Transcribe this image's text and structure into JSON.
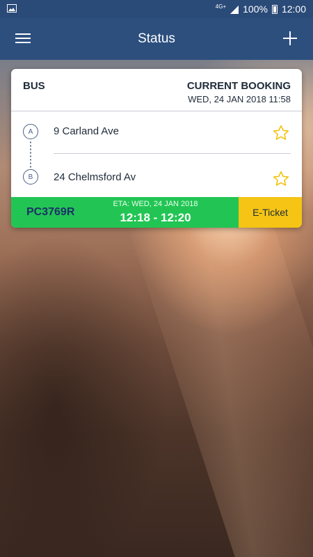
{
  "status_bar": {
    "network": "4G+",
    "battery": "100%",
    "time": "12:00"
  },
  "app_bar": {
    "title": "Status",
    "menu_icon": "hamburger-menu-icon",
    "add_icon": "plus-icon"
  },
  "booking": {
    "type": "BUS",
    "label": "CURRENT BOOKING",
    "datetime": "WED, 24 JAN 2018 11:58",
    "stops": [
      {
        "marker": "A",
        "address": "9 Carland Ave",
        "icon": "star-outline-icon"
      },
      {
        "marker": "B",
        "address": "24 Chelmsford Av",
        "icon": "star-outline-icon"
      }
    ],
    "code": "PC3769R",
    "eta_label": "ETA: WED, 24 JAN 2018",
    "eta_time": "12:18 - 12:20",
    "eticket_label": "E-Ticket"
  },
  "colors": {
    "app_bar": "#2c4f7e",
    "status_bar": "#2a4a78",
    "eta_green": "#22c553",
    "eticket_yellow": "#f5c414",
    "star": "#f1c40f",
    "code_text": "#1c2f69"
  }
}
